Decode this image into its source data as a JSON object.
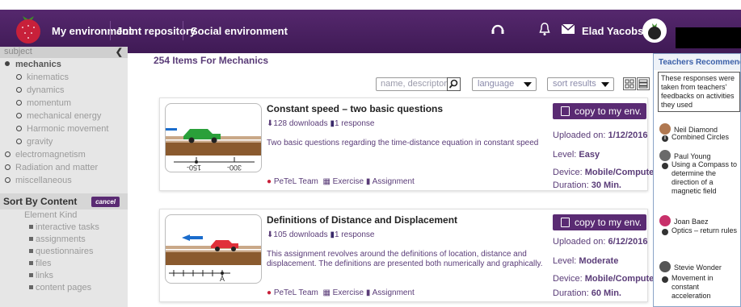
{
  "nav": {
    "items": [
      "My environment",
      "Joint repository",
      "Social environment"
    ],
    "user_name": "Elad Yacobson"
  },
  "sidebar": {
    "header": "subject",
    "items": [
      {
        "label": "mechanics",
        "level": 1,
        "active": true
      },
      {
        "label": "kinematics",
        "level": 2
      },
      {
        "label": "dynamics",
        "level": 2
      },
      {
        "label": "momentum",
        "level": 2
      },
      {
        "label": "mechanical energy",
        "level": 2
      },
      {
        "label": "Harmonic movement",
        "level": 2
      },
      {
        "label": "gravity",
        "level": 2
      },
      {
        "label": "electromagnetism",
        "level": 1
      },
      {
        "label": "Radiation and matter",
        "level": 1
      },
      {
        "label": "miscellaneous",
        "level": 1
      }
    ],
    "sort_title": "Sort By Content",
    "cancel_label": "cancel",
    "element_kind": "Element Kind",
    "kinds": [
      "interactive tasks",
      "assignments",
      "questionnaires",
      "files",
      "links",
      "content pages"
    ]
  },
  "main": {
    "title": "254 Items For Mechanics",
    "search_placeholder": "name, descripton",
    "language_label": "language",
    "sort_label": "sort results"
  },
  "cards": [
    {
      "title": "Constant speed – two basic questions",
      "downloads": "128 downloads",
      "responses": "1 response",
      "description": "Two basic questions regarding the time-distance equation in constant speed",
      "author": "PeTeL Team",
      "type1": "Exercise",
      "type2": "Assignment",
      "copy_label": "copy to my env.",
      "uploaded_label": "Uploaded on:",
      "uploaded": "1/12/2016",
      "level_label": "Level:",
      "level": "Easy",
      "device_label": "Device:",
      "device": "Mobile/Computer",
      "duration_label": "Duration:",
      "duration": "30 Min.",
      "thumb_labels": [
        "150-",
        "300-"
      ]
    },
    {
      "title": "Definitions of Distance and Displacement",
      "downloads": "105 downloads",
      "responses": "1 response",
      "description": "This assignment revolves around the definitions of location, distance and displacement. The definitions are presented both numerically and graphically.",
      "author": "PeTeL Team",
      "type1": "Exercise",
      "type2": "Assignment",
      "copy_label": "copy to my env.",
      "uploaded_label": "Uploaded on:",
      "uploaded": "6/12/2016",
      "level_label": "Level:",
      "level": "Moderate",
      "device_label": "Device:",
      "device": "Mobile/Computer",
      "duration_label": "Duration:",
      "duration": "60 Min.",
      "thumb_labels": [
        "A"
      ]
    }
  ],
  "recommend": {
    "title": "Teachers Recommending",
    "note": "These responses were taken from teachers' feedbacks on activities they used",
    "entries": [
      {
        "name": "Neil Diamond",
        "activity": "Combined Circles"
      },
      {
        "name": "Paul Young",
        "activity": "Using a Compass to determine the direction of a magnetic field"
      },
      {
        "name": "Joan Baez",
        "activity": "Optics – return rules"
      },
      {
        "name": "Stevie Wonder",
        "activity": "Movement in constant acceleration"
      }
    ]
  },
  "colors": {
    "brand_purple": "#5a2b73",
    "text_purple": "#5a3c78",
    "panel_blue": "#3a5fa8"
  }
}
